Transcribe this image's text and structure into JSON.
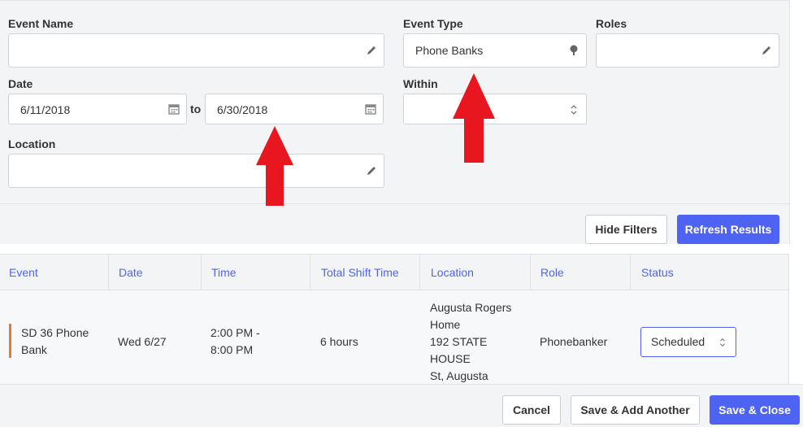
{
  "filters": {
    "event_name": {
      "label": "Event Name",
      "value": ""
    },
    "event_type": {
      "label": "Event Type",
      "value": "Phone Banks"
    },
    "roles": {
      "label": "Roles",
      "value": ""
    },
    "date": {
      "label": "Date",
      "from": "6/11/2018",
      "separator": "to",
      "to": "6/30/2018"
    },
    "within": {
      "label": "Within",
      "value": ""
    },
    "location": {
      "label": "Location",
      "value": ""
    },
    "hide_filters_label": "Hide Filters",
    "refresh_label": "Refresh Results"
  },
  "table": {
    "columns": [
      "Event",
      "Date",
      "Time",
      "Total Shift Time",
      "Location",
      "Role",
      "Status"
    ],
    "rows": [
      {
        "event": [
          "SD 36 Phone",
          "Bank"
        ],
        "date": "Wed 6/27",
        "time": [
          "2:00 PM -",
          "8:00 PM"
        ],
        "total": "6 hours",
        "location": [
          "Augusta Rogers",
          "Home",
          "192 STATE",
          "HOUSE",
          "St, Augusta"
        ],
        "role": "Phonebanker",
        "status": "Scheduled",
        "accent": "#e07b39"
      }
    ]
  },
  "footer": {
    "cancel_label": "Cancel",
    "save_add_label": "Save & Add Another",
    "save_close_label": "Save & Close"
  },
  "colors": {
    "accent": "#4f63f2",
    "arrow": "#e8161f"
  },
  "icons": [
    "pencil-icon",
    "tree-icon",
    "calendar-icon",
    "updown-chevron-icon",
    "red-arrow-up-icon"
  ]
}
